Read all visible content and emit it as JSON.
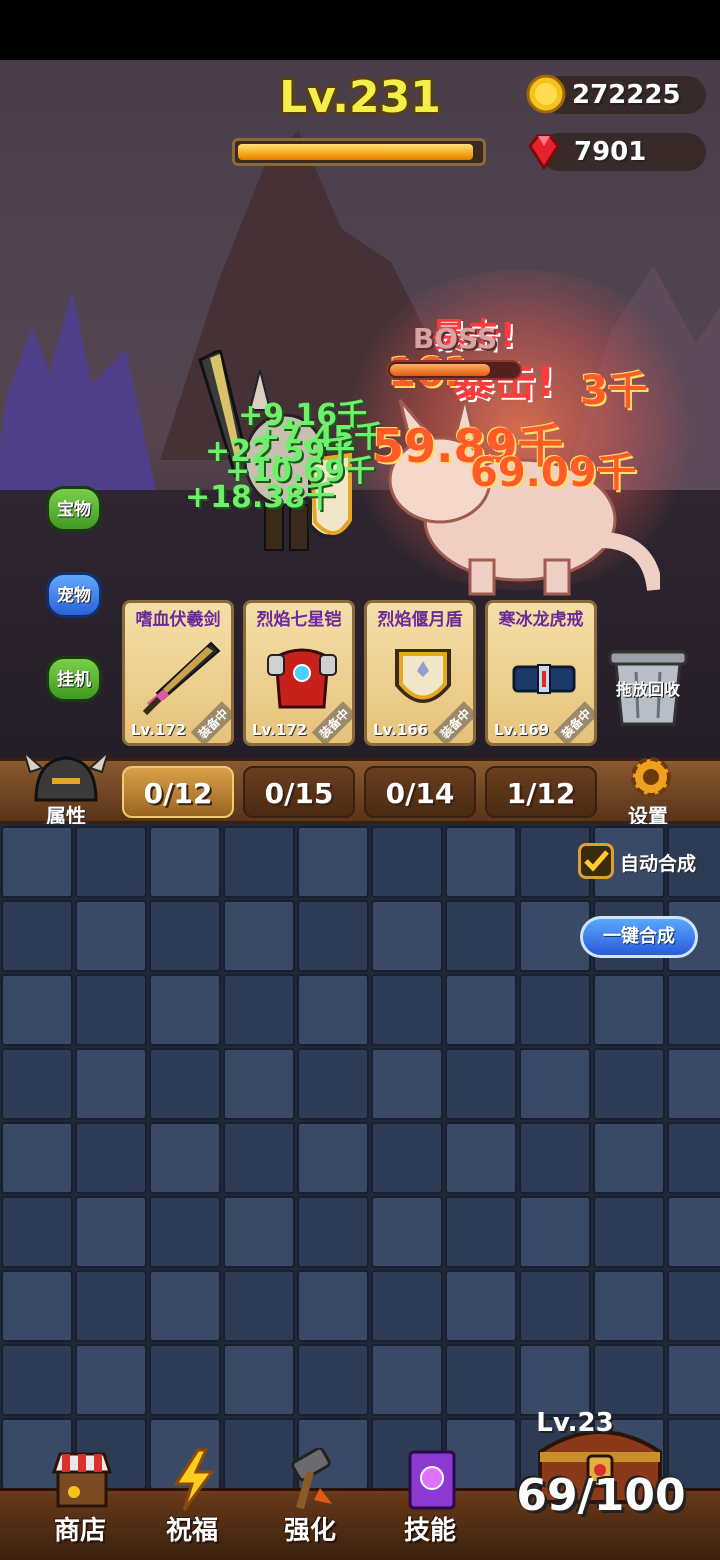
{
  "player": {
    "level": "Lv.231",
    "xp_fraction": 0.97
  },
  "currency": {
    "gold": "272225",
    "gems": "7901"
  },
  "boss": {
    "label": "BOSS",
    "hp_fraction": 0.78
  },
  "damage_numbers": {
    "green": [
      "+9.16千",
      "+7.45千",
      "+22.59千",
      "+10.69千",
      "+18.38千"
    ],
    "red": [
      "161",
      "3千",
      "59.89千",
      "69.09千"
    ],
    "crit": [
      "暴击!",
      "暴击!"
    ]
  },
  "side_buttons": {
    "treasure": "宝物",
    "pet": "宠物",
    "idle": "挂机"
  },
  "equipment": [
    {
      "name": "嗜血伏羲剑",
      "level": "Lv.172",
      "tag": "装备中"
    },
    {
      "name": "烈焰七星铠",
      "level": "Lv.172",
      "tag": "装备中"
    },
    {
      "name": "烈焰偃月盾",
      "level": "Lv.166",
      "tag": "装备中"
    },
    {
      "name": "寒冰龙虎戒",
      "level": "Lv.169",
      "tag": "装备中"
    }
  ],
  "recycle": {
    "label": "拖放回收"
  },
  "tabs": {
    "attributes_label": "属性",
    "settings_label": "设置",
    "items": [
      "0/12",
      "0/15",
      "0/14",
      "1/12"
    ]
  },
  "board": {
    "auto_merge_label": "自动合成",
    "one_click_merge_label": "一键合成"
  },
  "bottom_nav": {
    "shop": "商店",
    "blessing": "祝福",
    "enhance": "强化",
    "skills": "技能"
  },
  "chest": {
    "level": "Lv.23",
    "progress": "69/100"
  },
  "colors": {
    "level_yellow": "#f4f04a",
    "board_tile": "#3a4a66",
    "merge_blue": "#2a5ad8",
    "damage_green": "#6df06a",
    "damage_red": "#ff5a2a"
  }
}
